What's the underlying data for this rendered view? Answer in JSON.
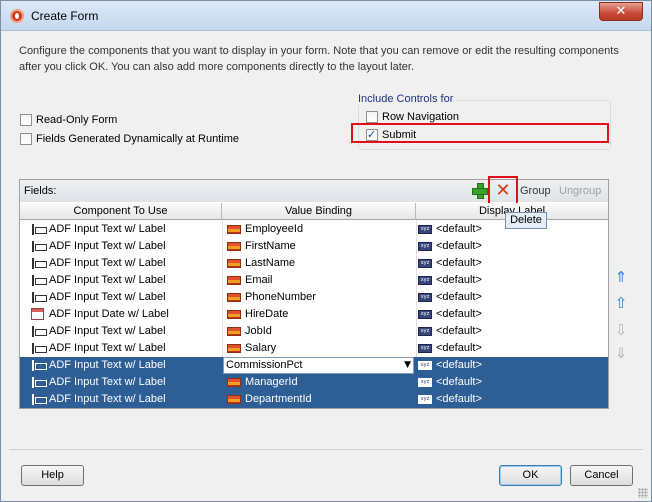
{
  "window": {
    "title": "Create Form",
    "close_glyph": "✕"
  },
  "description": "Configure the components that you want to display in your form. Note that you can remove or edit the resulting components after you click OK. You can also add more components directly to the layout later.",
  "options": {
    "read_only_form": {
      "label": "Read-Only Form",
      "checked": false
    },
    "fields_dynamic": {
      "label": "Fields Generated Dynamically at Runtime",
      "checked": false
    }
  },
  "include_controls": {
    "title": "Include Controls for",
    "row_navigation": {
      "label": "Row Navigation",
      "checked": false
    },
    "submit": {
      "label": "Submit",
      "checked": true
    }
  },
  "fields": {
    "label": "Fields:",
    "toolbar": {
      "add_icon": "add-icon",
      "delete_icon": "delete-icon",
      "group_label": "Group",
      "ungroup_label": "Ungroup",
      "delete_tooltip": "Delete"
    },
    "columns": [
      "Component To Use",
      "Value Binding",
      "Display Label"
    ],
    "rows": [
      {
        "component": "ADF Input Text w/ Label",
        "component_icon": "input-text-icon",
        "binding": "EmployeeId",
        "label": "<default>",
        "selected": false
      },
      {
        "component": "ADF Input Text w/ Label",
        "component_icon": "input-text-icon",
        "binding": "FirstName",
        "label": "<default>",
        "selected": false
      },
      {
        "component": "ADF Input Text w/ Label",
        "component_icon": "input-text-icon",
        "binding": "LastName",
        "label": "<default>",
        "selected": false
      },
      {
        "component": "ADF Input Text w/ Label",
        "component_icon": "input-text-icon",
        "binding": "Email",
        "label": "<default>",
        "selected": false
      },
      {
        "component": "ADF Input Text w/ Label",
        "component_icon": "input-text-icon",
        "binding": "PhoneNumber",
        "label": "<default>",
        "selected": false
      },
      {
        "component": "ADF Input Date w/ Label",
        "component_icon": "input-date-icon",
        "binding": "HireDate",
        "label": "<default>",
        "selected": false
      },
      {
        "component": "ADF Input Text w/ Label",
        "component_icon": "input-text-icon",
        "binding": "JobId",
        "label": "<default>",
        "selected": false
      },
      {
        "component": "ADF Input Text w/ Label",
        "component_icon": "input-text-icon",
        "binding": "Salary",
        "label": "<default>",
        "selected": false
      },
      {
        "component": "ADF Input Text w/ Label",
        "component_icon": "input-text-icon",
        "binding": "CommissionPct",
        "label": "<default>",
        "selected": true,
        "editing": true
      },
      {
        "component": "ADF Input Text w/ Label",
        "component_icon": "input-text-icon",
        "binding": "ManagerId",
        "label": "<default>",
        "selected": true
      },
      {
        "component": "ADF Input Text w/ Label",
        "component_icon": "input-text-icon",
        "binding": "DepartmentId",
        "label": "<default>",
        "selected": true
      }
    ]
  },
  "side_buttons": [
    {
      "icon": "move-to-top-icon",
      "glyph": "⇑",
      "enabled": true
    },
    {
      "icon": "move-up-icon",
      "glyph": "⇧",
      "enabled": true
    },
    {
      "icon": "move-down-icon",
      "glyph": "⇩",
      "enabled": false
    },
    {
      "icon": "move-to-bottom-icon",
      "glyph": "⇓",
      "enabled": false
    }
  ],
  "buttons": {
    "help": "Help",
    "ok": "OK",
    "cancel": "Cancel"
  },
  "colors": {
    "selection": "#2d5e96",
    "highlight_box": "#e0101a",
    "title_bar": "#c4d8ef"
  }
}
